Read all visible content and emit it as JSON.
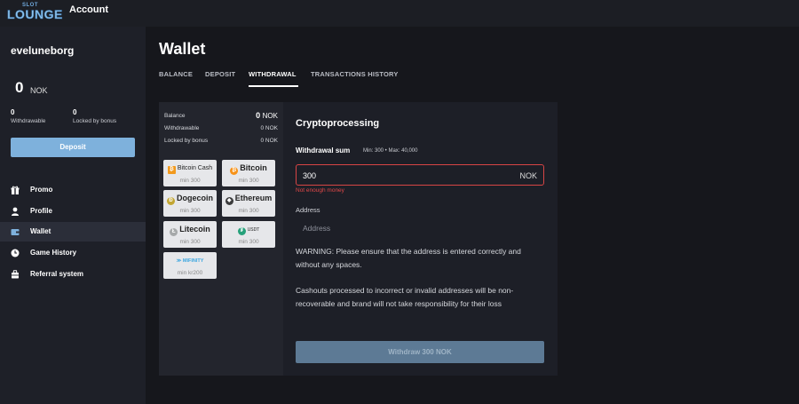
{
  "header": {
    "logo_top": "SLOT",
    "logo_main": "LOUNGE",
    "title": "Account"
  },
  "sidebar": {
    "username": "eveluneborg",
    "balance_value": "0",
    "balance_currency": "NOK",
    "withdrawable_value": "0",
    "withdrawable_label": "Withdrawable",
    "locked_value": "0",
    "locked_label": "Locked by bonus",
    "deposit_label": "Deposit",
    "menu": [
      {
        "label": "Promo",
        "icon": "gift-icon"
      },
      {
        "label": "Profile",
        "icon": "user-icon"
      },
      {
        "label": "Wallet",
        "icon": "wallet-icon",
        "active": true
      },
      {
        "label": "Game History",
        "icon": "clock-icon"
      },
      {
        "label": "Referral system",
        "icon": "people-icon"
      }
    ]
  },
  "main": {
    "title": "Wallet",
    "tabs": [
      "BALANCE",
      "DEPOSIT",
      "WITHDRAWAL",
      "TRANSACTIONS HISTORY"
    ],
    "active_tab": "WITHDRAWAL"
  },
  "summary": {
    "balance_label": "Balance",
    "balance_value": "0",
    "balance_currency": "NOK",
    "withdrawable_label": "Withdrawable",
    "withdrawable_value": "0 NOK",
    "locked_label": "Locked by bonus",
    "locked_value": "0 NOK"
  },
  "coins": [
    {
      "name": "Bitcoin Cash",
      "min": "min 300",
      "icon": "bitcoin-cash-icon",
      "color": "#f29a1e"
    },
    {
      "name": "Bitcoin",
      "min": "min 300",
      "icon": "bitcoin-icon",
      "color": "#f7931a"
    },
    {
      "name": "Dogecoin",
      "min": "min 300",
      "icon": "dogecoin-icon",
      "color": "#c2a633"
    },
    {
      "name": "Ethereum",
      "min": "min 300",
      "icon": "ethereum-icon",
      "color": "#3c3c3d"
    },
    {
      "name": "Litecoin",
      "min": "min 300",
      "icon": "litecoin-icon",
      "color": "#a6a9aa"
    },
    {
      "name": "USDT",
      "min": "min 300",
      "icon": "tether-icon",
      "color": "#26a17b"
    },
    {
      "name": "MIFINITY",
      "min": "min kr200",
      "icon": "mifinity-icon",
      "color": "#3ba6e0"
    }
  ],
  "form": {
    "title": "Cryptoprocessing",
    "sum_label": "Withdrawal sum",
    "sum_hint": "Min: 300 • Max: 40,000",
    "sum_value": "300",
    "sum_currency": "NOK",
    "error": "Not enough money",
    "address_label": "Address",
    "address_placeholder": "Address",
    "warning_1": "WARNING: Please ensure that the address is entered correctly and without any spaces.",
    "warning_2": "Cashouts processed to incorrect or invalid addresses will be non-recoverable and brand will not take responsibility for their loss",
    "submit_label": "Withdraw 300 NOK"
  }
}
